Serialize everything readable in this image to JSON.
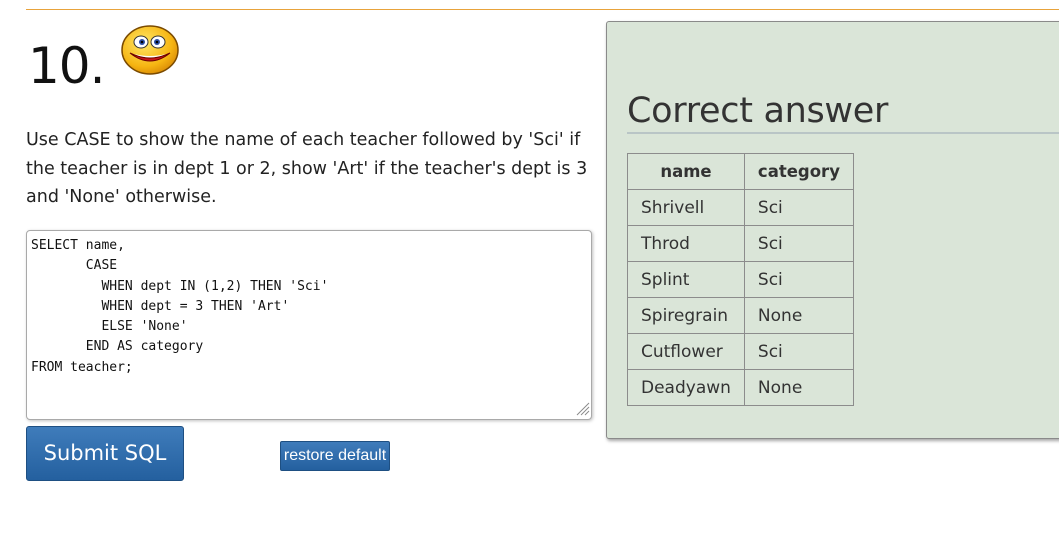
{
  "question": {
    "number": "10.",
    "text": "Use CASE to show the name of each teacher followed by 'Sci' if the teacher is in dept 1 or 2, show 'Art' if the teacher's dept is 3 and 'None' otherwise.",
    "icon": "smiley-icon"
  },
  "editor": {
    "sql": "SELECT name,\n       CASE\n         WHEN dept IN (1,2) THEN 'Sci'\n         WHEN dept = 3 THEN 'Art'\n         ELSE 'None'\n       END AS category\nFROM teacher;"
  },
  "buttons": {
    "submit_label": "Submit SQL",
    "restore_label": "restore default"
  },
  "answer": {
    "title": "Correct answer",
    "columns": [
      "name",
      "category"
    ],
    "rows": [
      [
        "Shrivell",
        "Sci"
      ],
      [
        "Throd",
        "Sci"
      ],
      [
        "Splint",
        "Sci"
      ],
      [
        "Spiregrain",
        "None"
      ],
      [
        "Cutflower",
        "Sci"
      ],
      [
        "Deadyawn",
        "None"
      ]
    ]
  },
  "colors": {
    "accent_rule": "#e8a33b",
    "button_blue": "#2f6dad",
    "panel_bg": "#dae5d8"
  }
}
